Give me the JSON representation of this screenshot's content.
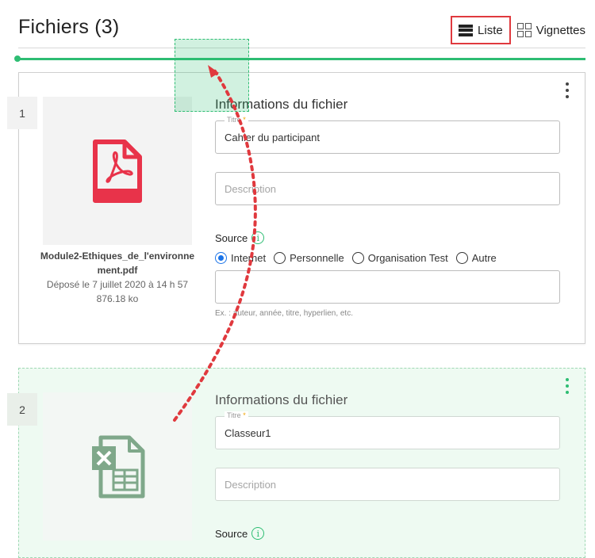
{
  "header": {
    "title": "Fichiers (3)",
    "view_list_label": "Liste",
    "view_thumbs_label": "Vignettes"
  },
  "files": [
    {
      "index": "1",
      "form_title": "Informations du fichier",
      "title_label": "Titre",
      "title_value": "Cahier du participant",
      "description_placeholder": "Description",
      "source_label": "Source",
      "source_options": [
        "Internet",
        "Personnelle",
        "Organisation Test",
        "Autre"
      ],
      "source_selected": "Internet",
      "source_value": "",
      "source_hint": "Ex. : auteur, année, titre, hyperlien, etc.",
      "file_name": "Module2-Ethiques_de_l'environnement.pdf",
      "file_date": "Déposé le 7 juillet 2020 à 14 h 57",
      "file_size": "876.18 ko",
      "icon": "pdf-icon"
    },
    {
      "index": "2",
      "form_title": "Informations du fichier",
      "title_label": "Titre",
      "title_value": "Classeur1",
      "description_placeholder": "Description",
      "source_label": "Source",
      "icon": "excel-icon"
    }
  ],
  "colors": {
    "accent": "#2ebd73",
    "pdf_red": "#e8334a",
    "excel_green": "#7fa88a",
    "highlight_red": "#e0393e",
    "radio_blue": "#1a73e8"
  }
}
